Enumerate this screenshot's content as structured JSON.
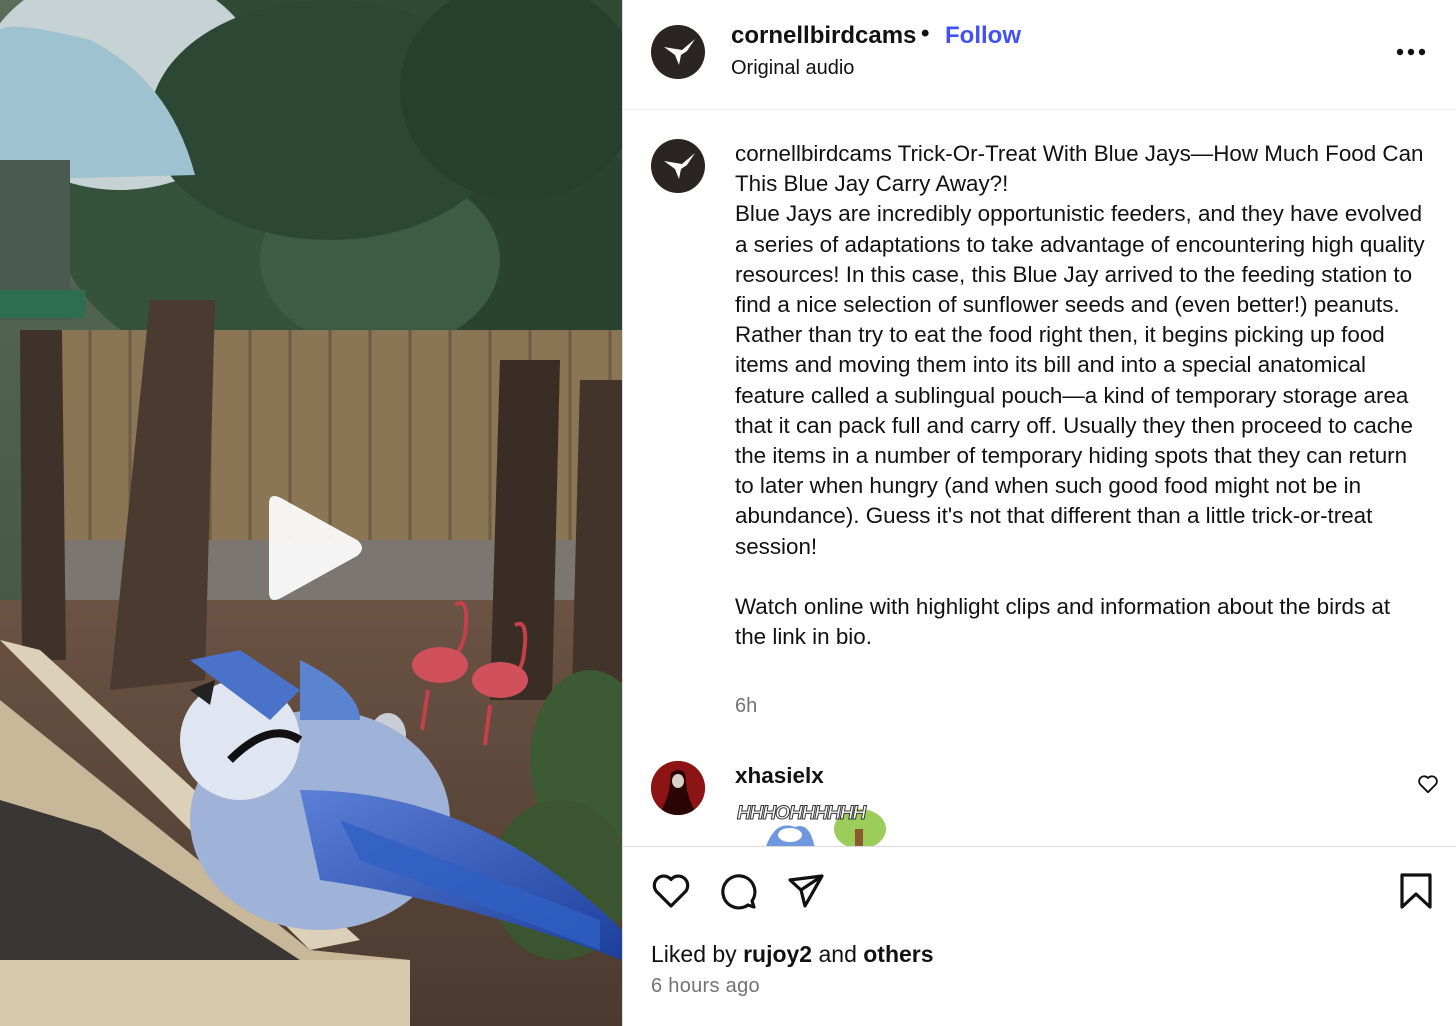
{
  "post": {
    "username": "cornellbirdcams",
    "separator": "•",
    "follow_label": "Follow",
    "audio_label": "Original audio",
    "more_icon": "more-horizontal-icon"
  },
  "caption": {
    "username": "cornellbirdcams",
    "text": "Trick-Or-Treat With Blue Jays—How Much Food Can This Blue Jay Carry Away?!\nBlue Jays are incredibly opportunistic feeders, and they have evolved a series of adaptations to take advantage of encountering high quality resources! In this case, this Blue Jay arrived to the feeding station to find a nice selection of sunflower seeds and (even better!) peanuts. Rather than try to eat the food right then, it begins picking up food items and moving them into its bill and into a special anatomical feature called a sublingual pouch—a kind of temporary storage area that it can pack full and carry off. Usually they then proceed to cache the items in a number of temporary hiding spots that they can return to later when hungry (and when such good food might not be in abundance). Guess it's not that different than a little trick-or-treat session!\n\nWatch online with highlight clips and information about the birds at the link in bio.",
    "time": "6h"
  },
  "comment": {
    "username": "xhasielx",
    "sticker_text": "HHHOHHHHHH"
  },
  "footer": {
    "liked_prefix": "Liked by",
    "liked_user": "rujoy2",
    "liked_and": "and",
    "liked_others": "others",
    "time_ago": "6 hours ago"
  },
  "colors": {
    "follow": "#4150f7",
    "muted": "#737373",
    "border": "#dbdbdb"
  }
}
